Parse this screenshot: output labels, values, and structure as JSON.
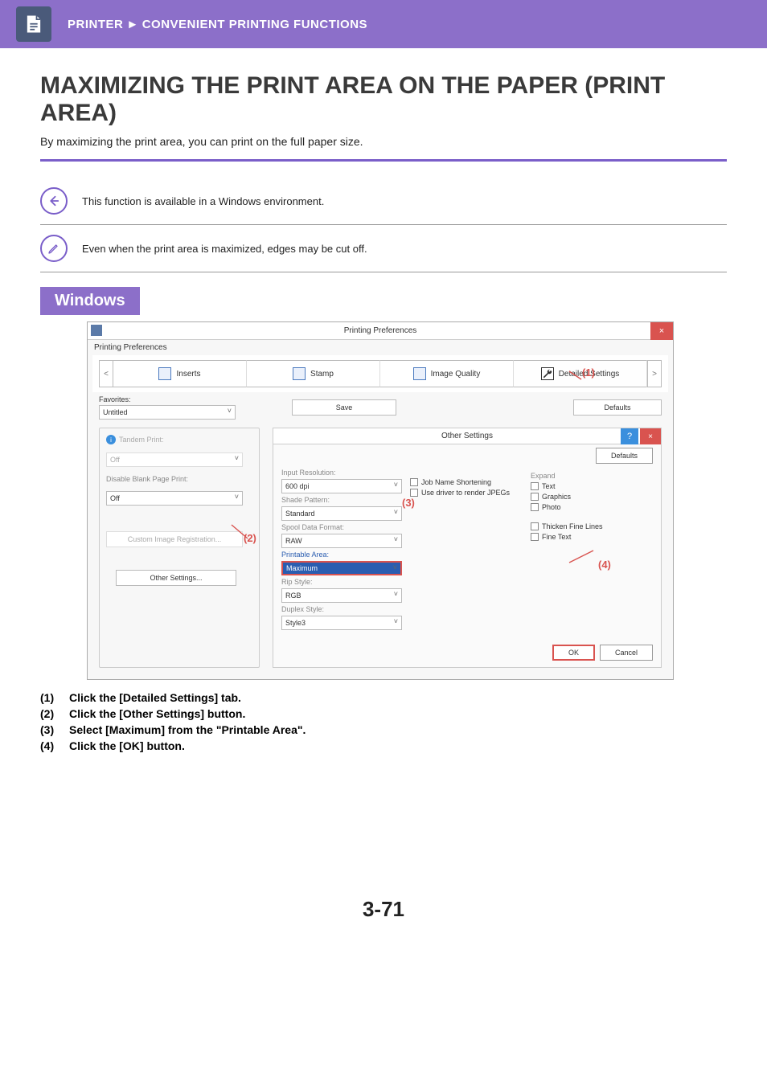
{
  "header": {
    "breadcrumb_left": "PRINTER",
    "breadcrumb_right": "CONVENIENT PRINTING FUNCTIONS"
  },
  "page": {
    "title": "MAXIMIZING THE PRINT AREA ON THE PAPER (PRINT AREA)",
    "subtitle": "By maximizing the print area, you can print on the full paper size.",
    "note1": "This function is available in a Windows environment.",
    "note2": "Even when the print area is maximized, edges may be cut off.",
    "section": "Windows",
    "page_number": "3-71"
  },
  "dialog": {
    "title": "Printing Preferences",
    "subtitle": "Printing Preferences",
    "tabs": {
      "inserts": "Inserts",
      "stamp": "Stamp",
      "image_quality": "Image Quality",
      "detailed": "Detailed Settings"
    },
    "fav_label": "Favorites:",
    "fav_value": "Untitled",
    "save_btn": "Save",
    "defaults_btn": "Defaults",
    "left": {
      "tandem_label": "Tandem Print:",
      "tandem_value": "Off",
      "blank_label": "Disable Blank Page Print:",
      "blank_value": "Off",
      "custom_btn": "Custom Image Registration...",
      "other_btn": "Other Settings..."
    },
    "sub": {
      "title": "Other Settings",
      "defaults_btn": "Defaults",
      "input_res_label": "Input Resolution:",
      "input_res_value": "600 dpi",
      "shade_label": "Shade Pattern:",
      "shade_value": "Standard",
      "spool_label": "Spool Data Format:",
      "spool_value": "RAW",
      "area_label": "Printable Area:",
      "area_value": "Maximum",
      "rip_label": "Rip Style:",
      "rip_value": "RGB",
      "duplex_label": "Duplex Style:",
      "duplex_value": "Style3",
      "chk_job": "Job Name Shortening",
      "chk_jpeg": "Use driver to render JPEGs",
      "expand_label": "Expand",
      "chk_text": "Text",
      "chk_graphics": "Graphics",
      "chk_photo": "Photo",
      "chk_thicken": "Thicken Fine Lines",
      "chk_fine": "Fine Text",
      "ok": "OK",
      "cancel": "Cancel"
    },
    "markers": {
      "m1": "(1)",
      "m2": "(2)",
      "m3": "(3)",
      "m4": "(4)"
    }
  },
  "steps": {
    "s1n": "(1)",
    "s1": "Click the [Detailed Settings] tab.",
    "s2n": "(2)",
    "s2": "Click the [Other Settings] button.",
    "s3n": "(3)",
    "s3": "Select [Maximum] from the \"Printable Area\".",
    "s4n": "(4)",
    "s4": "Click the [OK] button."
  }
}
